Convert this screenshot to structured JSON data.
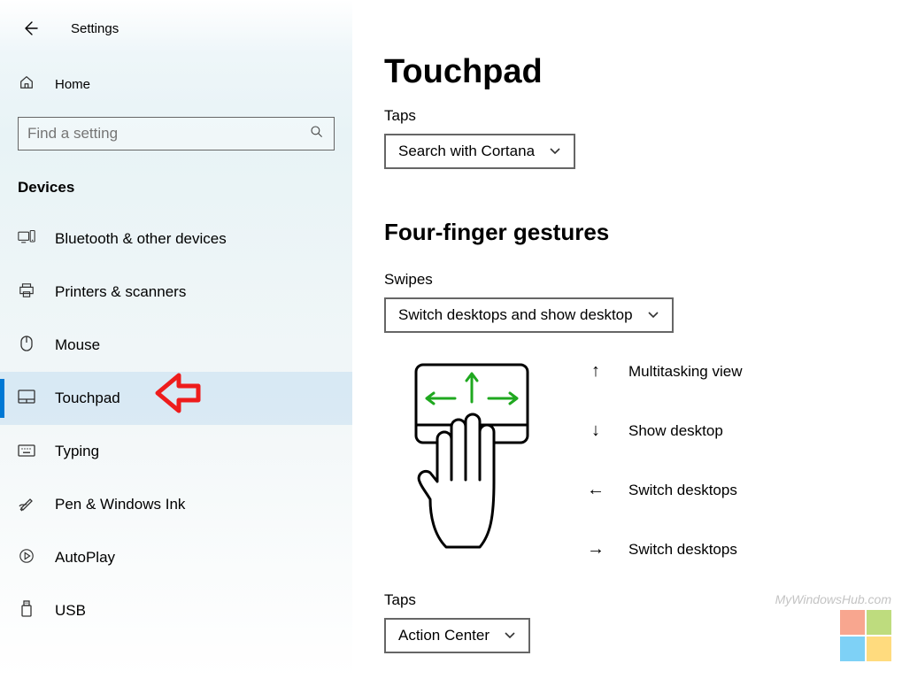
{
  "header": {
    "title": "Settings"
  },
  "home_label": "Home",
  "search": {
    "placeholder": "Find a setting"
  },
  "category_label": "Devices",
  "sidebar": {
    "items": [
      {
        "label": "Bluetooth & other devices"
      },
      {
        "label": "Printers & scanners"
      },
      {
        "label": "Mouse"
      },
      {
        "label": "Touchpad"
      },
      {
        "label": "Typing"
      },
      {
        "label": "Pen & Windows Ink"
      },
      {
        "label": "AutoPlay"
      },
      {
        "label": "USB"
      }
    ]
  },
  "main": {
    "title": "Touchpad",
    "taps_label": "Taps",
    "taps_dropdown_value": "Search with Cortana",
    "section_title": "Four-finger gestures",
    "swipes_label": "Swipes",
    "swipes_dropdown_value": "Switch desktops and show desktop",
    "legend": {
      "up": "Multitasking view",
      "down": "Show desktop",
      "left": "Switch desktops",
      "right": "Switch desktops"
    },
    "taps2_label": "Taps",
    "taps2_dropdown_value": "Action Center"
  },
  "watermark_text": "MyWindowsHub.com"
}
